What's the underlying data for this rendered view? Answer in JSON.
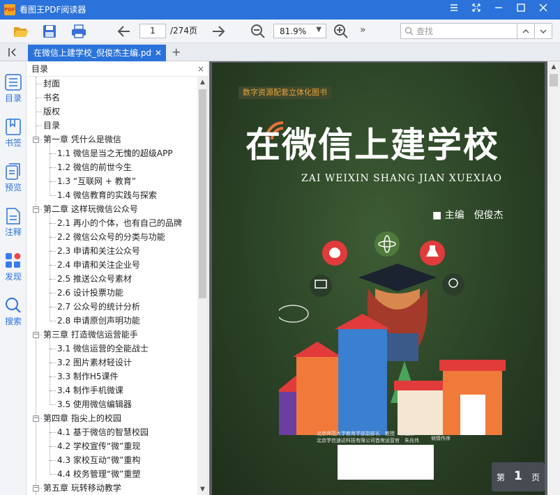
{
  "app": {
    "title": "看图王PDF阅读器",
    "logo_text": "PDF"
  },
  "window": {
    "menu_icon": "hamburger-icon",
    "fullscreen_icon": "expand-icon",
    "minimize_icon": "minimize-icon",
    "maximize_icon": "maximize-icon",
    "close_icon": "close-icon"
  },
  "toolbar": {
    "page_value": "1",
    "page_total": "/274页",
    "zoom_value": "81.9%",
    "more": "»",
    "search_placeholder": "查找"
  },
  "tab": {
    "label": "在微信上建学校_倪俊杰主编.pdf",
    "close": "✕",
    "add": "+"
  },
  "rail": [
    {
      "label": "目录",
      "icon": "list-icon"
    },
    {
      "label": "书签",
      "icon": "bookmark-icon"
    },
    {
      "label": "预览",
      "icon": "thumbnails-icon"
    },
    {
      "label": "注释",
      "icon": "annotation-icon"
    },
    {
      "label": "发现",
      "icon": "apps-icon"
    },
    {
      "label": "搜索",
      "icon": "search-icon"
    }
  ],
  "outline": {
    "title": "目录",
    "close": "×",
    "items": [
      {
        "text": "封面",
        "level": 0,
        "toggle": ""
      },
      {
        "text": "书名",
        "level": 0,
        "toggle": ""
      },
      {
        "text": "版权",
        "level": 0,
        "toggle": ""
      },
      {
        "text": "目录",
        "level": 0,
        "toggle": ""
      },
      {
        "text": "第一章 凭什么是微信",
        "level": 0,
        "toggle": "−"
      },
      {
        "text": "1.1 微信是当之无愧的超级APP",
        "level": 1,
        "toggle": ""
      },
      {
        "text": "1.2 微信的前世今生",
        "level": 1,
        "toggle": ""
      },
      {
        "text": "1.3 “互联网 + 教育”",
        "level": 1,
        "toggle": ""
      },
      {
        "text": "1.4 微信教育的实践与探索",
        "level": 1,
        "toggle": ""
      },
      {
        "text": "第二章 这样玩微信公众号",
        "level": 0,
        "toggle": "−"
      },
      {
        "text": "2.1 再小的个体，也有自己的品牌",
        "level": 1,
        "toggle": ""
      },
      {
        "text": "2.2 微信公众号的分类与功能",
        "level": 1,
        "toggle": ""
      },
      {
        "text": "2.3 申请和关注公众号",
        "level": 1,
        "toggle": ""
      },
      {
        "text": "2.4 申请和关注企业号",
        "level": 1,
        "toggle": ""
      },
      {
        "text": "2.5 推送公众号素材",
        "level": 1,
        "toggle": ""
      },
      {
        "text": "2.6 设计投票功能",
        "level": 1,
        "toggle": ""
      },
      {
        "text": "2.7 公众号的统计分析",
        "level": 1,
        "toggle": ""
      },
      {
        "text": "2.8 申请原创声明功能",
        "level": 1,
        "toggle": ""
      },
      {
        "text": "第三章 打造微信运营能手",
        "level": 0,
        "toggle": "−"
      },
      {
        "text": "3.1 微信运营的全能战士",
        "level": 1,
        "toggle": ""
      },
      {
        "text": "3.2 图片素材轻设计",
        "level": 1,
        "toggle": ""
      },
      {
        "text": "3.3 制作H5课件",
        "level": 1,
        "toggle": ""
      },
      {
        "text": "3.4 制作手机微课",
        "level": 1,
        "toggle": ""
      },
      {
        "text": "3.5 使用微信编辑器",
        "level": 1,
        "toggle": ""
      },
      {
        "text": "第四章 指尖上的校园",
        "level": 0,
        "toggle": "−"
      },
      {
        "text": "4.1 基于微信的智慧校园",
        "level": 1,
        "toggle": ""
      },
      {
        "text": "4.2 学校宣传“微”重现",
        "level": 1,
        "toggle": ""
      },
      {
        "text": "4.3 家校互动“微”重构",
        "level": 1,
        "toggle": ""
      },
      {
        "text": "4.4 校务管理“微”重塑",
        "level": 1,
        "toggle": ""
      },
      {
        "text": "第五章 玩转移动教学",
        "level": 0,
        "toggle": "−"
      }
    ]
  },
  "cover": {
    "series": "数字资源配套立体化图书",
    "title": "在微信上建学校",
    "pinyin": "ZAI WEIXIN SHANG JIAN XUEXIAO",
    "editor": "■ 主编　倪俊杰",
    "publisher_1": "北京师范大学教育学部副部长　教授　余胜泉",
    "publisher_2": "北京学信速达科技有限公司首席运营官　朱兆伟",
    "publisher_3": "倾情作序"
  },
  "page_badge": {
    "prefix": "第",
    "number": "1",
    "suffix": "页"
  },
  "colors": {
    "accent": "#2b73db",
    "cover_bg": "#2b4226",
    "title_text": "#ffffff",
    "series_text": "#e8a13c"
  }
}
